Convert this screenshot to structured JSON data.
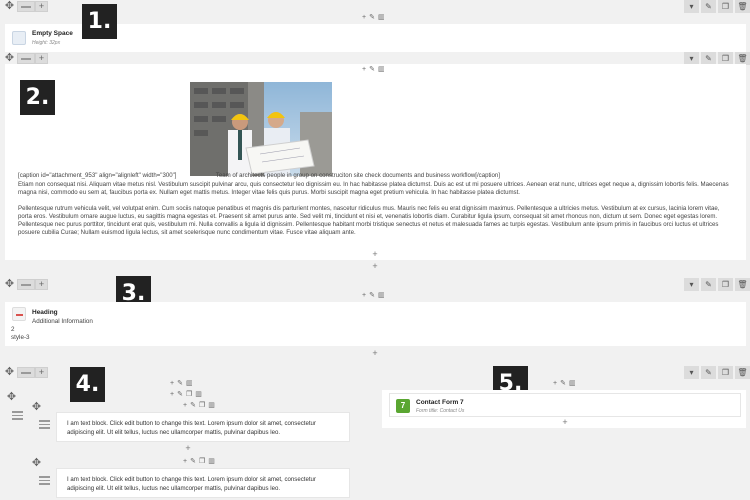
{
  "tool_icons": {
    "move": "move-icon",
    "add": "plus-icon",
    "edit": "pencil-icon",
    "copy": "copy-icon",
    "delete": "trash-icon",
    "dropdown": "caret-down-icon"
  },
  "badges": [
    "1.",
    "2.",
    "3.",
    "4.",
    "5."
  ],
  "empty_space": {
    "title": "Empty Space",
    "subtitle": "Height: 32px"
  },
  "image_block": {
    "caption": "[caption id=\"attachment_953\" align=\"alignleft\" width=\"300\"]",
    "caption_tail": "Team of architects people in group on construciton site check documents and business workflow[/caption]",
    "para1": "Etiam non consequat nisi. Aliquam vitae metus nisl. Vestibulum suscipit pulvinar arcu, quis consectetur leo dignissim eu. In hac habitasse platea dictumst. Duis ac est ut mi posuere ultrices. Aenean erat nunc, ultrices eget neque a, dignissim lobortis felis. Maecenas magna nisi, commodo eu sem at, faucibus porta ex. Nullam eget mattis metus. Integer vitae felis quis purus. Morbi suscipit magna eget pretium vehicula. In hac habitasse platea dictumst.",
    "para2": "Pellentesque rutrum vehicula velit, vel volutpat enim. Cum sociis natoque penatibus et magnis dis parturient montes, nascetur ridiculus mus. Mauris nec felis eu erat dignissim maximus. Pellentesque a ultricies metus. Vestibulum at ex cursus, lacinia lorem vitae, porta eros. Vestibulum ornare augue luctus, eu sagittis magna egestas et. Praesent sit amet purus ante. Sed velit mi, tincidunt et nisi et, venenatis lobortis diam. Curabitur ligula ipsum, consequat sit amet rhoncus non, dictum ut sem. Donec eget egestas lorem. Pellentesque nec purus porttitor, tincidunt erat quis, vestibulum mi. Nulla convallis a ligula id dignissim. Pellentesque habitant morbi tristique senectus et netus et malesuada fames ac turpis egestas. Vestibulum ante ipsum primis in faucibus orci luctus et ultrices posuere cubilia Curae; Nullam euismod ligula lectus, sit amet scelerisque nunc condimentum vitae. Fusce vitae aliquam ante."
  },
  "heading": {
    "title": "Heading",
    "subtitle": "Additional Information",
    "line1": "2",
    "line2": "style-3"
  },
  "text_blocks": [
    "I am text block. Click edit button to change this text. Lorem ipsum dolor sit amet, consectetur adipiscing elit. Ut elit tellus, luctus nec ullamcorper mattis, pulvinar dapibus leo.",
    "I am text block. Click edit button to change this text. Lorem ipsum dolor sit amet, consectetur adipiscing elit. Ut elit tellus, luctus nec ullamcorper mattis, pulvinar dapibus leo."
  ],
  "contact_form": {
    "badge": "7",
    "title": "Contact Form 7",
    "subtitle": "Form title: Contact Us"
  },
  "colors": {
    "accent_green": "#5aa631",
    "heading_icon_red": "#d9534f",
    "badge_bg": "#222222"
  }
}
